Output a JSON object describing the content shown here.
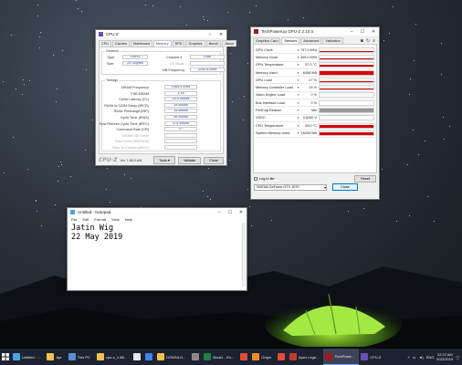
{
  "cpuz": {
    "title": "CPU-Z",
    "tabs": [
      "CPU",
      "Caches",
      "Mainboard",
      "Memory",
      "SPD",
      "Graphics",
      "Bench",
      "About"
    ],
    "active_tab": "Memory",
    "general": {
      "label": "General",
      "type_label": "Type",
      "type_value": "DDR4",
      "size_label": "Size",
      "size_value": "24 GBytes",
      "channel_label": "Channel #",
      "channel_value": "Dual",
      "dcmode_label": "DC Mode",
      "dcmode_value": "",
      "nbfreq_label": "NB Frequency",
      "nbfreq_value": "3192.8 MHz"
    },
    "timings": {
      "label": "Timings",
      "rows": [
        {
          "label": "DRAM Frequency",
          "value": "1064.4 MHz"
        },
        {
          "label": "FSB:DRAM",
          "value": "1:16"
        },
        {
          "label": "CAS# Latency (CL)",
          "value": "15.0 clocks"
        },
        {
          "label": "RAS# to CAS# Delay (tRCD)",
          "value": "15 clocks"
        },
        {
          "label": "RAS# Precharge (tRP)",
          "value": "15 clocks"
        },
        {
          "label": "Cycle Time (tRAS)",
          "value": "36 clocks"
        },
        {
          "label": "Row Refresh Cycle Time (tRFC)",
          "value": "374 clocks"
        },
        {
          "label": "Command Rate (CR)",
          "value": "2T"
        },
        {
          "label": "DRAM Idle Timer",
          "value": ""
        },
        {
          "label": "Total CAS# (tRDRAM)",
          "value": ""
        },
        {
          "label": "Row To Column (tRCD)",
          "value": ""
        }
      ]
    },
    "brand": "CPU-Z",
    "version": "Ver. 1.88.0.x64",
    "tools_label": "Tools",
    "validate_label": "Validate",
    "close_label": "Close"
  },
  "gpuz": {
    "title": "TechPowerUp GPU-Z 2.10.0",
    "tabs": [
      "Graphics Card",
      "Sensors",
      "Advanced",
      "Validation"
    ],
    "active_tab": "Sensors",
    "sensors": [
      {
        "name": "GPU Clock",
        "value": "797.0 MHz",
        "level": 0.2,
        "grey": false
      },
      {
        "name": "Memory Clock",
        "value": "405.0 MHz",
        "level": 0.2,
        "grey": false
      },
      {
        "name": "GPU Temperature",
        "value": "57.0 °C",
        "level": 0.6,
        "grey": false
      },
      {
        "name": "Memory Used",
        "value": "6458 MB",
        "level": 0.8,
        "grey": false
      },
      {
        "name": "GPU Load",
        "value": "27 %",
        "level": 0.3,
        "grey": false
      },
      {
        "name": "Memory Controller Load",
        "value": "24 %",
        "level": 0.25,
        "grey": false
      },
      {
        "name": "Video Engine Load",
        "value": "0 %",
        "level": 0.0,
        "grey": false
      },
      {
        "name": "Bus Interface Load",
        "value": "0 %",
        "level": 0.03,
        "grey": false
      },
      {
        "name": "PerfCap Reason",
        "value": "Idle",
        "level": 1.0,
        "grey": true
      },
      {
        "name": "VDDC",
        "value": "0.6250 V",
        "level": 0.15,
        "grey": false
      },
      {
        "name": "CPU Temperature",
        "value": "59.0 °C",
        "level": 0.6,
        "grey": false
      },
      {
        "name": "System Memory Used",
        "value": "16200 MB",
        "level": 0.7,
        "grey": false
      }
    ],
    "log_label": "Log to file",
    "reset_label": "Reset",
    "gpu_select": "NVIDIA GeForce GTX 1070",
    "close_label": "Close"
  },
  "notepad": {
    "title": "Untitled - Notepad",
    "menu": [
      "File",
      "Edit",
      "Format",
      "View",
      "Help"
    ],
    "lines": [
      "Jatin Wig",
      "22 May 2019"
    ]
  },
  "taskbar": {
    "items": [
      {
        "label": "Untitled - ...",
        "color": "#4aa3df"
      },
      {
        "label": "Apr",
        "color": "#f2c14e"
      },
      {
        "label": "This PC",
        "color": "#5a8fd6"
      },
      {
        "label": "cpu-z_1.88...",
        "color": "#f2c14e"
      },
      {
        "label": "",
        "color": "#e8e8e8"
      },
      {
        "label": "",
        "color": "#3b82f6"
      },
      {
        "label": "DOWNLO...",
        "color": "#f2c14e"
      },
      {
        "label": "",
        "color": "#8a8a8a"
      },
      {
        "label": "Book1 - Ex...",
        "color": "#1e7e45"
      },
      {
        "label": "",
        "color": "#e24a3b"
      },
      {
        "label": "Origin",
        "color": "#f08a24"
      },
      {
        "label": "",
        "color": "#e24a3b"
      },
      {
        "label": "Apex Lege...",
        "color": "#c0392b"
      },
      {
        "label": "TechPowe...",
        "color": "#9b1c1c"
      },
      {
        "label": "CPU-Z",
        "color": "#6b4fb3"
      }
    ],
    "active_item": "TechPowe...",
    "tray_lang": "ENG",
    "time": "12:22 AM",
    "date": "5/22/2019"
  }
}
